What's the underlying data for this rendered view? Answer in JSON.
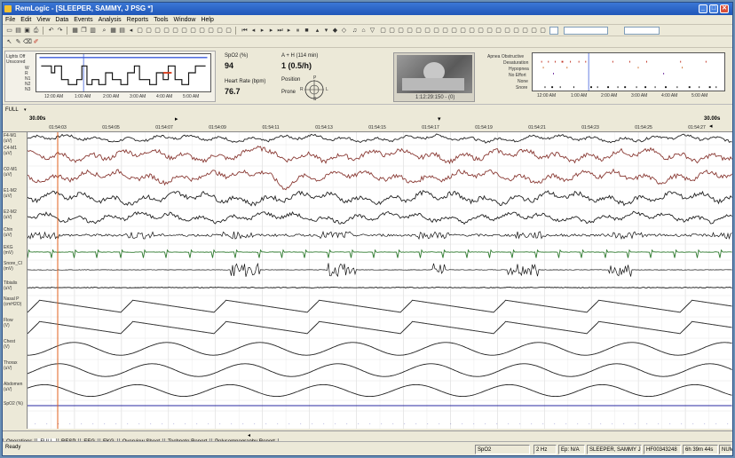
{
  "window": {
    "title": "RemLogic - [SLEEPER, SAMMY, J PSG *]",
    "minimize": "_",
    "maximize": "□",
    "close": "✕"
  },
  "menu": [
    "File",
    "Edit",
    "View",
    "Data",
    "Events",
    "Analysis",
    "Reports",
    "Tools",
    "Window",
    "Help"
  ],
  "hypnogram": {
    "stages": [
      "Lights Off",
      "Unscored",
      "W",
      "R",
      "N1",
      "N2",
      "N3"
    ],
    "times": [
      "12:00 AM",
      "1:00 AM",
      "2:00 AM",
      "3:00 AM",
      "4:00 AM",
      "5:00 AM"
    ]
  },
  "vitals": {
    "spo2_label": "SpO2 (%)",
    "spo2_value": "94",
    "hr_label": "Heart Rate (bpm)",
    "hr_value": "76.7",
    "ahi_label": "A + H (114 min)",
    "ahi_value": "1 (0.5/h)",
    "position_label": "Position",
    "position_value": "Prone",
    "compass": {
      "p": "P",
      "s": "S",
      "l": "L",
      "r": "R"
    }
  },
  "video": {
    "timestamp": "1:12:29:150 - (0)"
  },
  "events_panel": {
    "labels": [
      "Apnea Obstructive",
      "Desaturation",
      "Hypopnea",
      "No Effort",
      "None",
      "Snore"
    ],
    "times": [
      "12:00 AM",
      "1:00 AM",
      "2:00 AM",
      "3:00 AM",
      "4:00 AM",
      "5:00 AM"
    ]
  },
  "epoch": {
    "mode": "FULL",
    "window_left": "30.00s",
    "window_right": "30.00s",
    "ticks": [
      "01:54:03",
      "01:54:05",
      "01:54:07",
      "01:54:09",
      "01:54:11",
      "01:54:13",
      "01:54:15",
      "01:54:17",
      "01:54:19",
      "01:54:21",
      "01:54:23",
      "01:54:25",
      "01:54:27"
    ]
  },
  "channels": [
    {
      "label": "F4-M1",
      "unit": "(uV)",
      "color": "#222222"
    },
    {
      "label": "C4-M1",
      "unit": "(uV)",
      "color": "#8a3a34"
    },
    {
      "label": "O2-M1",
      "unit": "(uV)",
      "color": "#8a3a34"
    },
    {
      "label": "E1-M2",
      "unit": "(uV)",
      "color": "#222222"
    },
    {
      "label": "E2-M2",
      "unit": "(uV)",
      "color": "#222222"
    },
    {
      "label": "Chin",
      "unit": "(uV)",
      "color": "#111111"
    },
    {
      "label": "EKG",
      "unit": "(mV)",
      "color": "#2f7a2f"
    },
    {
      "label": "Snore_Cl",
      "unit": "(mV)",
      "color": "#111111"
    },
    {
      "label": "Tibialis",
      "unit": "(uV)",
      "color": "#111111"
    },
    {
      "label": "Nasal P",
      "unit": "(cmH2O)",
      "color": "#222222"
    },
    {
      "label": "Flow",
      "unit": "(V)",
      "color": "#222222"
    },
    {
      "label": "Chest",
      "unit": "(V)",
      "color": "#222222"
    },
    {
      "label": "Thorax",
      "unit": "(uV)",
      "color": "#222222"
    },
    {
      "label": "Abdomen",
      "unit": "(uV)",
      "color": "#222222"
    },
    {
      "label": "SpO2 (%)",
      "unit": "",
      "color": "#2a2aa0"
    }
  ],
  "tabs": [
    "Operations",
    "FULL",
    "RESP",
    "EEG",
    "EKG",
    "Overview Sheet",
    "Technote Report",
    "Polysomnography Report"
  ],
  "active_tab": "FULL",
  "status": {
    "ready": "Ready",
    "channel": "SpO2",
    "rate": "2 Hz",
    "ep": "Ep: N/A",
    "patient": "SLEEPER, SAMMY J",
    "id": "HF00343248",
    "duration": "6h 39m 44s",
    "num": "NUM"
  }
}
